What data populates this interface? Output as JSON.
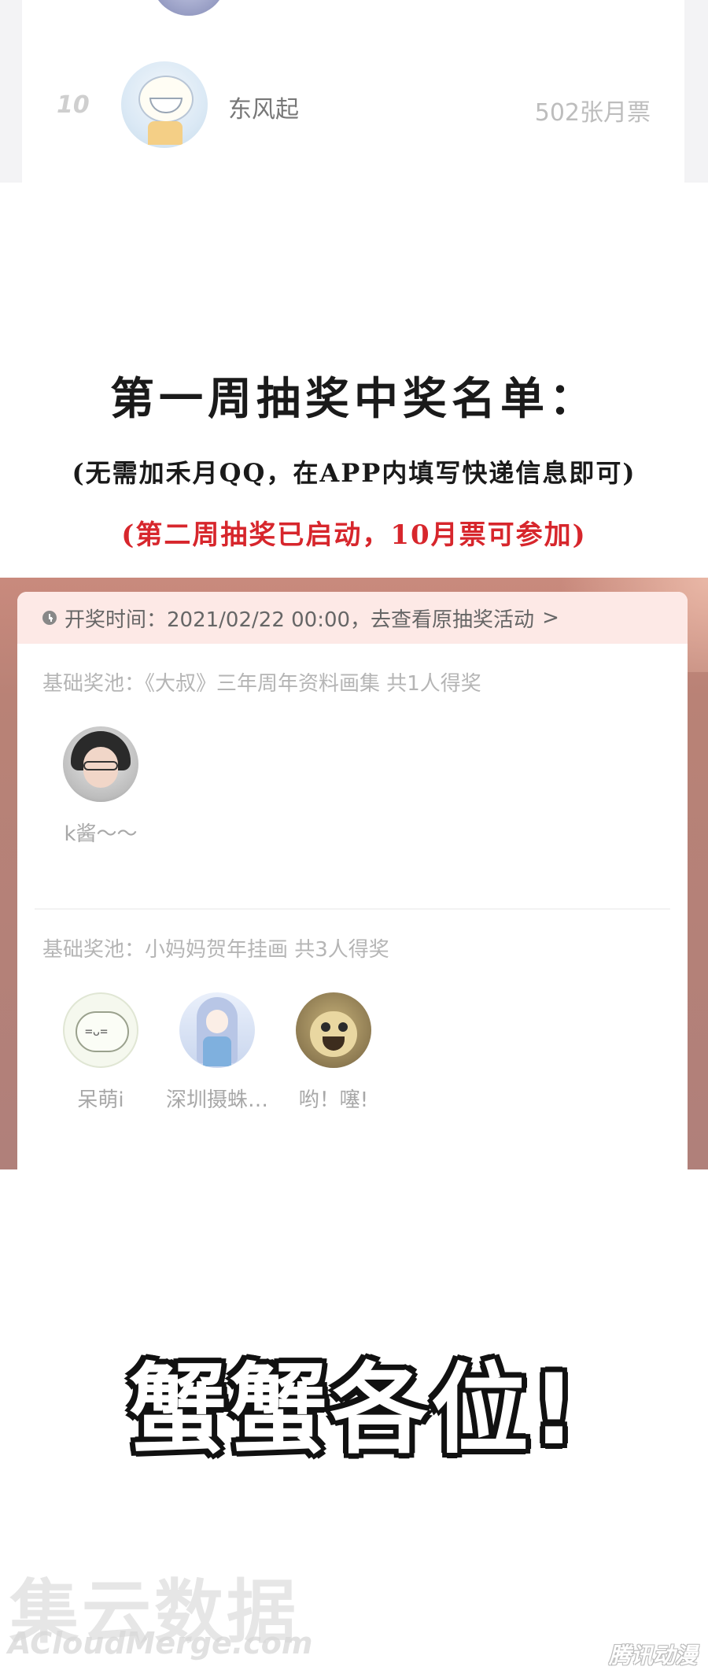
{
  "ranking": {
    "rank": "10",
    "name": "东风起",
    "votes": "502张月票"
  },
  "headings": {
    "title": "第一周抽奖中奖名单：",
    "note": "(无需加禾月QQ，在APP内填写快递信息即可)",
    "notice": "(第二周抽奖已启动，10月票可参加)"
  },
  "lottery": {
    "header_text": "开奖时间：2021/02/22 00:00，去查看原抽奖活动",
    "header_link_arrow": ">",
    "pools": [
      {
        "title": "基础奖池：《大叔》三年周年资料画集 共1人得奖",
        "winners": [
          {
            "name": "k酱～～"
          }
        ]
      },
      {
        "title": "基础奖池：小妈妈贺年挂画 共3人得奖",
        "winners": [
          {
            "name": "呆萌i"
          },
          {
            "name": "深圳摄蛛…"
          },
          {
            "name": "哟！噻!"
          }
        ]
      }
    ],
    "colors": {
      "header_bg": "#fde9e6",
      "frame_bg": "#b98276"
    }
  },
  "greeting": "蟹蟹各位!",
  "watermark": {
    "main": "集云数据",
    "sub": "ACloudMerge.com",
    "corner": "腾讯动漫"
  }
}
